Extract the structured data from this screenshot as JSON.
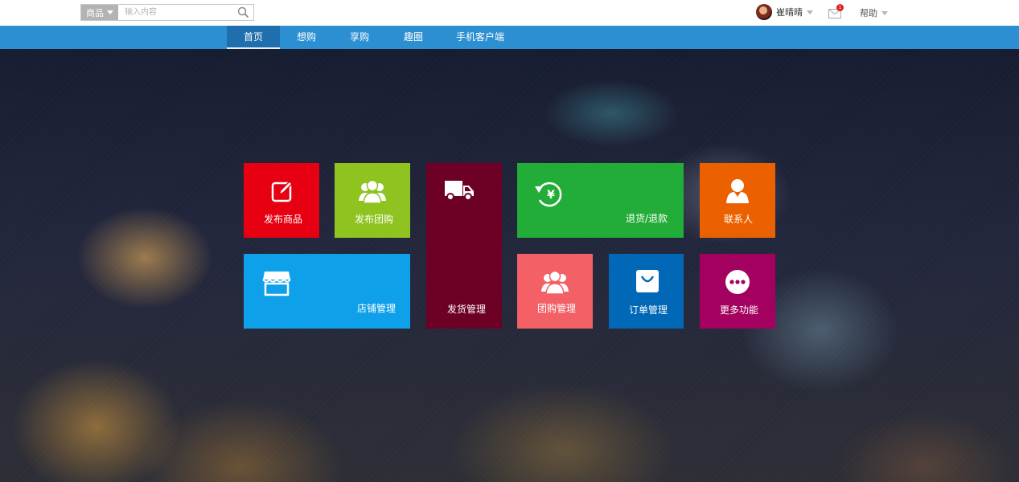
{
  "search": {
    "category": "商品",
    "placeholder": "输入内容"
  },
  "user": {
    "name": "崔晴晴",
    "mail_badge": "1",
    "help": "帮助"
  },
  "nav": {
    "items": [
      {
        "label": "首页",
        "active": true
      },
      {
        "label": "想购"
      },
      {
        "label": "享购"
      },
      {
        "label": "趣圈"
      },
      {
        "label": "手机客户端"
      }
    ]
  },
  "tiles": [
    {
      "label": "发布商品",
      "color": "#e60012",
      "icon": "edit-icon"
    },
    {
      "label": "发布团购",
      "color": "#8fc31f",
      "icon": "group-icon"
    },
    {
      "label": "发货管理",
      "color": "#6d0025",
      "icon": "truck-icon"
    },
    {
      "label": "退货/退款",
      "color": "#22ac38",
      "icon": "refund-icon"
    },
    {
      "label": "联系人",
      "color": "#eb6100",
      "icon": "contact-icon"
    },
    {
      "label": "店铺管理",
      "color": "#0ea0e8",
      "icon": "store-icon"
    },
    {
      "label": "团购管理",
      "color": "#f36066",
      "icon": "group-icon"
    },
    {
      "label": "订单管理",
      "color": "#0068b7",
      "icon": "shopping-bag-icon"
    },
    {
      "label": "更多功能",
      "color": "#a40060",
      "icon": "more-icon"
    }
  ]
}
